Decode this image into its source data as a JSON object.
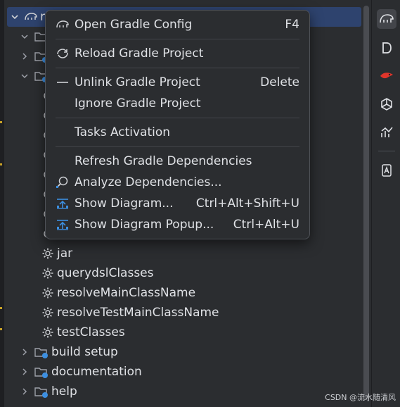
{
  "tree": {
    "root_label": "re",
    "tasks": [
      "jar",
      "querydslClasses",
      "resolveMainClassName",
      "resolveTestMainClassName",
      "testClasses"
    ],
    "groups": [
      "build setup",
      "documentation",
      "help"
    ]
  },
  "menu": {
    "items": [
      {
        "label": "Open Gradle Config",
        "shortcut": "F4",
        "icon": "gradle-elephant-icon"
      },
      {
        "label": "Reload Gradle Project",
        "shortcut": "",
        "icon": "reload-icon"
      },
      {
        "label": "Unlink Gradle Project",
        "shortcut": "Delete",
        "icon": "dash-icon"
      },
      {
        "label": "Ignore Gradle Project",
        "shortcut": "",
        "icon": ""
      },
      {
        "label": "Tasks Activation",
        "shortcut": "",
        "icon": ""
      },
      {
        "label": "Refresh Gradle Dependencies",
        "shortcut": "",
        "icon": ""
      },
      {
        "label": "Analyze Dependencies...",
        "shortcut": "",
        "icon": "analyze-search-icon"
      },
      {
        "label": "Show Diagram...",
        "shortcut": "Ctrl+Alt+Shift+U",
        "icon": "diagram-icon"
      },
      {
        "label": "Show Diagram Popup...",
        "shortcut": "Ctrl+Alt+U",
        "icon": "diagram-icon"
      }
    ]
  },
  "toolstrip": [
    "gradle-icon",
    "d-letter-icon",
    "bird-icon",
    "ai-assistant-icon",
    "chart-icon",
    "bookmark-icon"
  ],
  "watermark": "CSDN @流水随清风"
}
